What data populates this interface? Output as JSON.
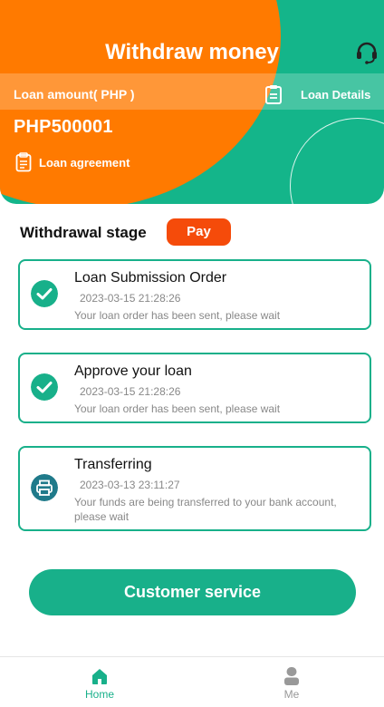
{
  "header": {
    "title": "Withdraw money",
    "support_icon": "headset-icon",
    "loan_amount_label": "Loan amount( PHP )",
    "loan_details_label": "Loan Details",
    "loan_details_icon": "clipboard-icon",
    "amount_value": "PHP500001",
    "agreement_label": "Loan agreement",
    "agreement_icon": "document-icon",
    "colors": {
      "orange": "#ff7a00",
      "green": "#14b58a"
    }
  },
  "stage": {
    "title": "Withdrawal stage",
    "pay_label": "Pay",
    "pay_color": "#f54b0a"
  },
  "steps": [
    {
      "title": "Loan Submission Order",
      "time": "2023-03-15 21:28:26",
      "description": "Your loan order has been sent, please wait",
      "status": "done",
      "icon": "check-circle-icon"
    },
    {
      "title": "Approve your loan",
      "time": "2023-03-15 21:28:26",
      "description": "Your loan order has been sent, please wait",
      "status": "done",
      "icon": "check-circle-icon"
    },
    {
      "title": "Transferring",
      "time": "2023-03-13 23:11:27",
      "description": "Your funds are being transferred to your bank account, please wait",
      "status": "in-progress",
      "icon": "printer-icon"
    }
  ],
  "customer_service_label": "Customer service",
  "nav": {
    "items": [
      {
        "label": "Home",
        "icon": "home-icon",
        "active": true
      },
      {
        "label": "Me",
        "icon": "user-icon",
        "active": false
      }
    ],
    "active_color": "#18b08a",
    "inactive_color": "#999999"
  }
}
